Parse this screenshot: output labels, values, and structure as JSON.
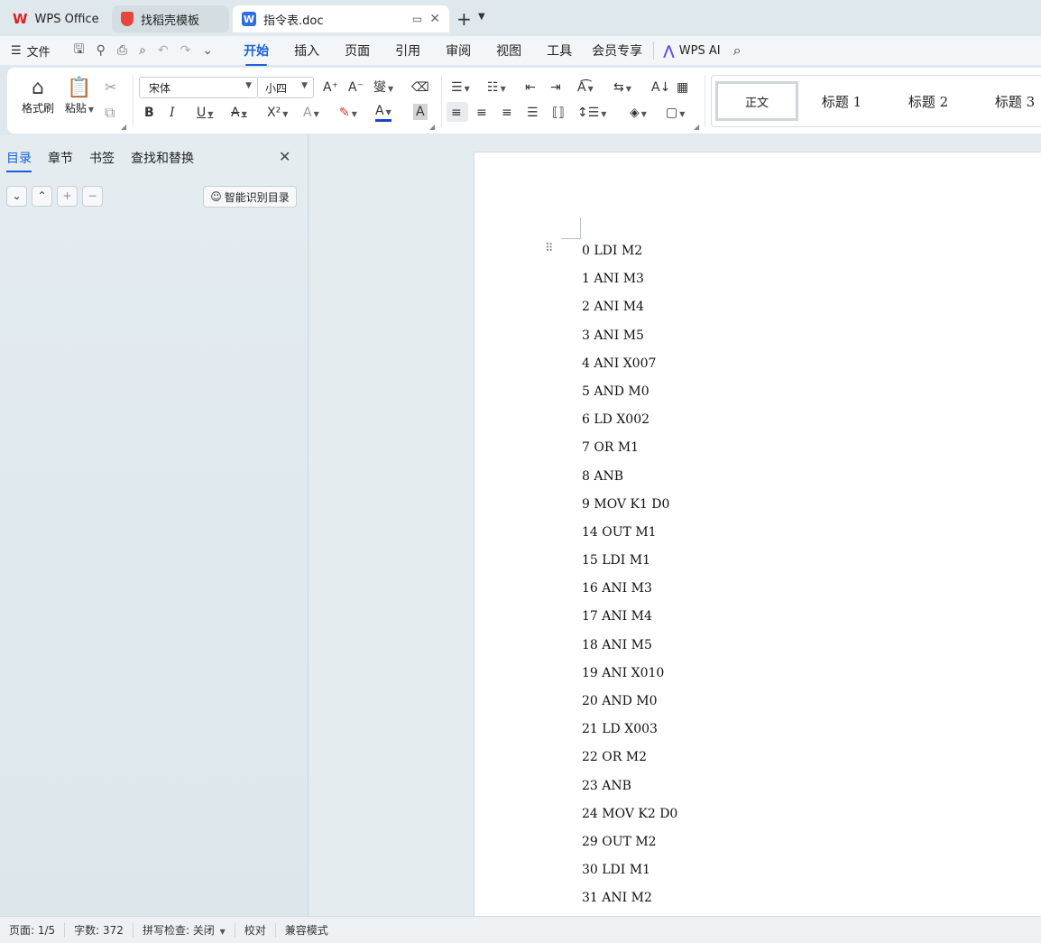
{
  "tabs": [
    {
      "label": "WPS Office"
    },
    {
      "label": "找稻壳模板"
    },
    {
      "label": "指令表.doc"
    }
  ],
  "menubar": {
    "file_label": "文件",
    "tabs": [
      "开始",
      "插入",
      "页面",
      "引用",
      "审阅",
      "视图",
      "工具",
      "会员专享"
    ],
    "ai_label": "WPS AI"
  },
  "ribbon": {
    "format_painter": "格式刷",
    "paste": "粘贴",
    "font_name": "宋体",
    "font_size": "小四",
    "styles": [
      "正文",
      "标题 1",
      "标题 2",
      "标题 3"
    ]
  },
  "nav": {
    "tabs": [
      "目录",
      "章节",
      "书签",
      "查找和替换"
    ],
    "smart_toc_label": "智能识别目录"
  },
  "document": {
    "lines": [
      "0 LDI M2",
      "1 ANI M3",
      "2 ANI M4",
      "3 ANI M5",
      "4 ANI X007",
      "5 AND M0",
      "6 LD X002",
      "7 OR M1",
      "8 ANB",
      "9 MOV K1 D0",
      "14 OUT M1",
      "15 LDI M1",
      "16 ANI M3",
      "17 ANI M4",
      "18 ANI M5",
      "19 ANI X010",
      "20 AND M0",
      "21 LD X003",
      "22 OR M2",
      "23 ANB",
      "24 MOV K2 D0",
      "29 OUT M2",
      "30 LDI M1",
      "31 ANI M2"
    ]
  },
  "status": {
    "page": "页面: 1/5",
    "words": "字数: 372",
    "spell": "拼写检查: 关闭",
    "proof": "校对",
    "compat": "兼容模式"
  }
}
